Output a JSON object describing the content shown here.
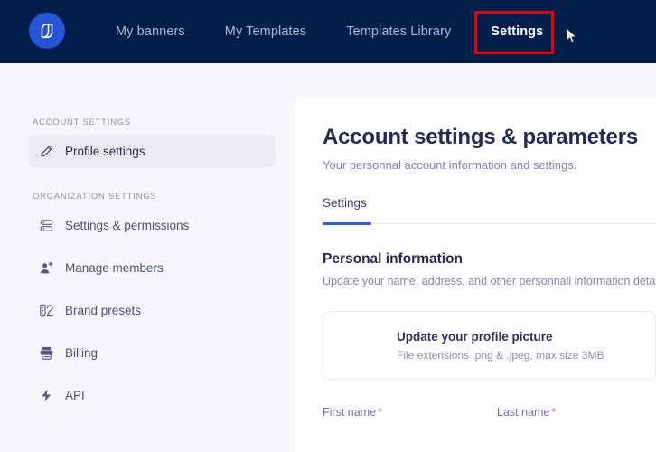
{
  "topbar": {
    "logo_icon": "app-logo-icon",
    "brand_color": "#2355d6",
    "background_color": "#021f4b",
    "nav": [
      {
        "label": "My banners",
        "active": false
      },
      {
        "label": "My Templates",
        "active": false
      },
      {
        "label": "Templates Library",
        "active": false
      },
      {
        "label": "Settings",
        "active": true
      }
    ],
    "highlight_color": "#ee0000",
    "cursor_icon": "mouse-pointer-icon"
  },
  "sidebar": {
    "account_caption": "ACCOUNT SETTINGS",
    "organization_caption": "ORGANIZATION SETTINGS",
    "account_items": [
      {
        "label": "Profile settings",
        "icon": "pencil-icon",
        "active": true
      }
    ],
    "organization_items": [
      {
        "label": "Settings & permissions",
        "icon": "server-stack-icon",
        "active": false
      },
      {
        "label": "Manage members",
        "icon": "user-plus-icon",
        "active": false
      },
      {
        "label": "Brand presets",
        "icon": "brand-presets-icon",
        "active": false
      },
      {
        "label": "Billing",
        "icon": "billing-printer-icon",
        "active": false
      },
      {
        "label": "API",
        "icon": "lightning-bolt-icon",
        "active": false
      }
    ]
  },
  "main": {
    "title": "Account settings & parameters",
    "subtitle": "Your personnal account information and settings.",
    "tabs": [
      {
        "label": "Settings",
        "active": true
      }
    ],
    "section": {
      "title": "Personal information",
      "subtitle": "Update your name, address, and other personnall information details"
    },
    "upload": {
      "title": "Update your profile picture",
      "hint": "File extensions .png & .jpeg, max size 3MB"
    },
    "fields": [
      {
        "label": "First name",
        "required": "*",
        "value": "",
        "placeholder": ""
      },
      {
        "label": "Last name",
        "required": "*",
        "value": "",
        "placeholder": ""
      }
    ]
  }
}
